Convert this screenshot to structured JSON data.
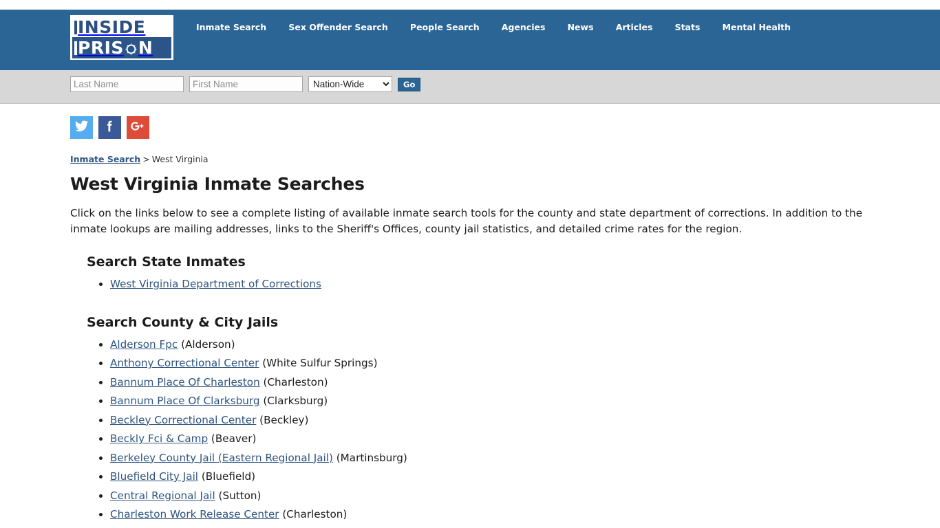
{
  "site": {
    "logo": {
      "line1": "INSIDE",
      "line2_prefix": "PRIS",
      "line2_suffix": "N",
      "o_icon": "barbed-wire-circle-icon"
    },
    "nav": [
      {
        "label": "Inmate Search"
      },
      {
        "label": "Sex Offender Search"
      },
      {
        "label": "People Search"
      },
      {
        "label": "Agencies"
      },
      {
        "label": "News"
      },
      {
        "label": "Articles"
      },
      {
        "label": "Stats"
      },
      {
        "label": "Mental Health"
      }
    ],
    "colors": {
      "header_blue": "#2a6596",
      "logo_blue": "#2b5488",
      "search_band_gray": "#d7d7d7",
      "link_blue": "#2e5580",
      "twitter": "#55acee",
      "facebook": "#3b5998",
      "googleplus": "#dd4b39"
    }
  },
  "search": {
    "last_name_placeholder": "Last Name",
    "last_name_value": "",
    "first_name_placeholder": "First Name",
    "first_name_value": "",
    "region_selected": "Nation-Wide",
    "region_options": [
      "Nation-Wide"
    ],
    "go_label": "Go"
  },
  "social": [
    {
      "name": "twitter",
      "glyph": "twitter-icon"
    },
    {
      "name": "facebook",
      "glyph": "facebook-icon"
    },
    {
      "name": "googleplus",
      "glyph": "googleplus-icon"
    }
  ],
  "breadcrumb": {
    "root_label": "Inmate Search",
    "separator": ">",
    "current_label": "West Virginia"
  },
  "main": {
    "title": "West Virginia Inmate Searches",
    "intro": "Click on the links below to see a complete listing of available inmate search tools for the county and state department of corrections. In addition to the inmate lookups are mailing addresses, links to the Sheriff's Offices, county jail statistics, and detailed crime rates for the region.",
    "state_section": {
      "heading": "Search State Inmates",
      "items": [
        {
          "link": "West Virginia Department of Corrections",
          "city": ""
        }
      ]
    },
    "county_section": {
      "heading": "Search County & City Jails",
      "items": [
        {
          "link": "Alderson Fpc",
          "city": "(Alderson)"
        },
        {
          "link": "Anthony Correctional Center",
          "city": "(White Sulfur Springs)"
        },
        {
          "link": "Bannum Place Of Charleston",
          "city": "(Charleston)"
        },
        {
          "link": "Bannum Place Of Clarksburg",
          "city": "(Clarksburg)"
        },
        {
          "link": "Beckley Correctional Center",
          "city": "(Beckley)"
        },
        {
          "link": "Beckly Fci & Camp",
          "city": "(Beaver)"
        },
        {
          "link": "Berkeley County Jail (Eastern Regional Jail)",
          "city": "(Martinsburg)"
        },
        {
          "link": "Bluefield City Jail",
          "city": "(Bluefield)"
        },
        {
          "link": "Central Regional Jail",
          "city": "(Sutton)"
        },
        {
          "link": "Charleston Work Release Center",
          "city": "(Charleston)"
        }
      ]
    }
  }
}
